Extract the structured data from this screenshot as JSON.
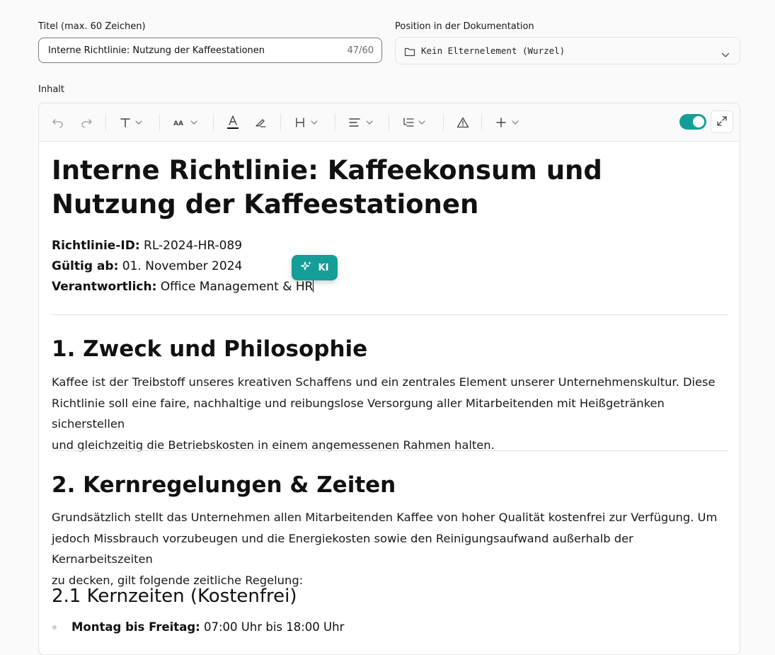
{
  "form": {
    "title_label": "Titel (max. 60 Zeichen)",
    "title_value": "Interne Richtlinie: Nutzung der Kaffeestationen",
    "title_counter": "47/60",
    "position_label": "Position in der Dokumentation",
    "position_value": "Kein Elternelement (Wurzel)",
    "content_label": "Inhalt"
  },
  "toolbar": {
    "icons": [
      "undo-icon",
      "redo-icon",
      "text-type-icon",
      "font-size-icon",
      "text-color-icon",
      "highlight-icon",
      "heading-icon",
      "align-icon",
      "list-icon",
      "warning-icon",
      "plus-icon",
      "expand-icon"
    ],
    "toggle_on": true,
    "accent": "#159e97"
  },
  "ai_button": {
    "label": "KI"
  },
  "doc": {
    "title": "Interne Richtlinie: Kaffeekonsum und Nutzung der Kaffeestationen",
    "meta": [
      {
        "key": "Richtlinie-ID:",
        "value": "RL-2024-HR-089"
      },
      {
        "key": "Gültig ab:",
        "value": "01. November 2024"
      },
      {
        "key": "Verantwortlich:",
        "value": "Office Management & HR"
      }
    ],
    "section1": {
      "heading": "1. Zweck und Philosophie",
      "lines": [
        "Kaffee ist der Treibstoff unseres kreativen Schaffens und ein zentrales Element unserer Unternehmenskultur. Diese",
        "Richtlinie soll eine faire, nachhaltige und reibungslose Versorgung aller Mitarbeitenden mit Heißgetränken sicherstellen",
        "und gleichzeitig die Betriebskosten in einem angemessenen Rahmen halten."
      ]
    },
    "section2": {
      "heading": "2. Kernregelungen & Zeiten",
      "lines": [
        "Grundsätzlich stellt das Unternehmen allen Mitarbeitenden Kaffee von hoher Qualität kostenfrei zur Verfügung. Um",
        "jedoch Missbrauch vorzubeugen und die Energiekosten sowie den Reinigungsaufwand außerhalb der Kernarbeitszeiten",
        "zu decken, gilt folgende zeitliche Regelung:"
      ],
      "sub_heading": "2.1 Kernzeiten (Kostenfrei)",
      "items": [
        {
          "key": "Montag bis Freitag:",
          "value": "07:00 Uhr bis 18:00 Uhr"
        }
      ]
    }
  }
}
